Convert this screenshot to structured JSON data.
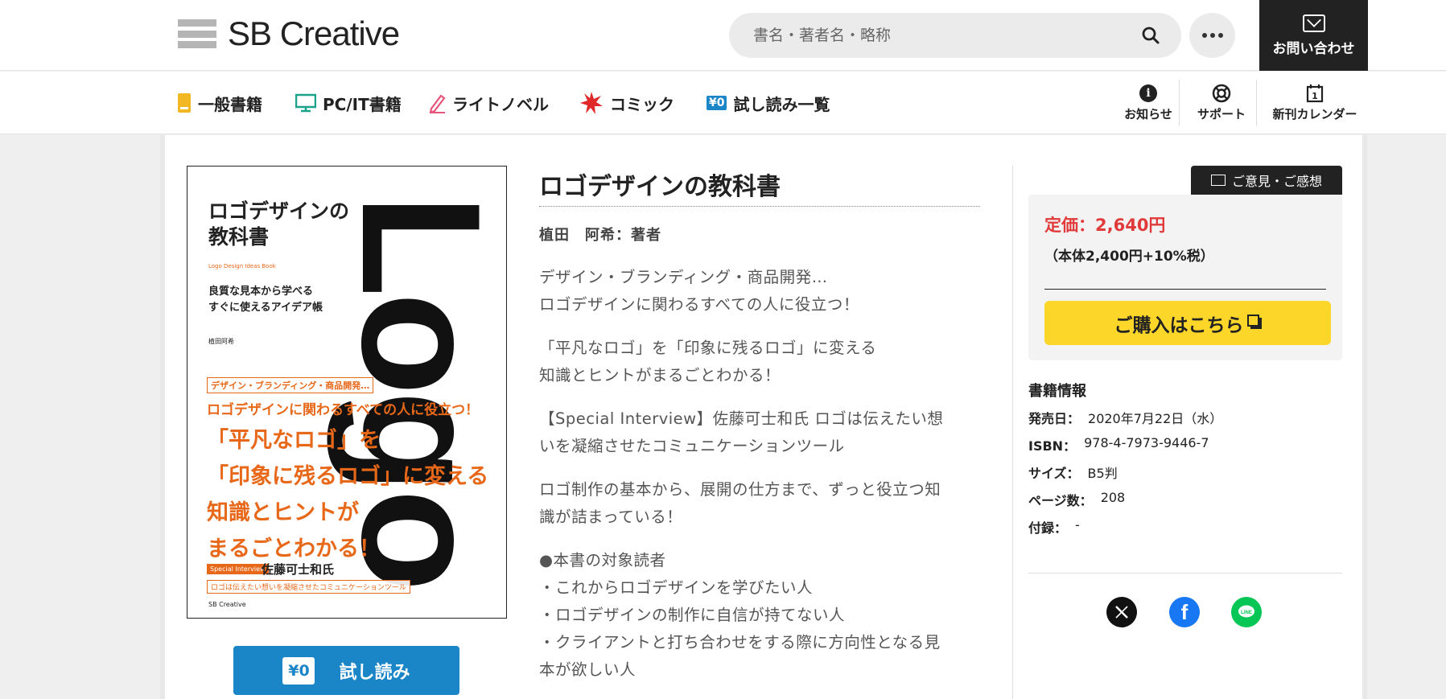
{
  "header": {
    "logo_text": "SB Creative",
    "search_placeholder": "書名・著者名・略称",
    "contact_label": "お問い合わせ"
  },
  "nav": {
    "items": [
      {
        "label": "一般書籍",
        "icon": "book-icon",
        "color": "#f2b824"
      },
      {
        "label": "PC/IT書籍",
        "icon": "monitor-icon",
        "color": "#1aa38a"
      },
      {
        "label": "ライトノベル",
        "icon": "pencil-icon",
        "color": "#e8557a"
      },
      {
        "label": "コミック",
        "icon": "burst-icon",
        "color": "#e02a2a"
      },
      {
        "label": "試し読み一覧",
        "icon": "yen-zero-icon",
        "color": "#1a86c8"
      }
    ],
    "right": [
      {
        "label": "お知らせ",
        "icon": "info-icon"
      },
      {
        "label": "サポート",
        "icon": "lifebuoy-icon"
      },
      {
        "label": "新刊カレンダー",
        "icon": "calendar-icon"
      }
    ]
  },
  "cover": {
    "title_line1": "ロゴデザインの",
    "title_line2": "教科書",
    "subtitle_en": "Logo Design Ideas Book",
    "tagline1": "良質な見本から学べる",
    "tagline2": "すぐに使えるアイデア帳",
    "author": "植田阿希",
    "big_letters": "Logo",
    "orange1": "デザイン・ブランディング・商品開発…",
    "orange2": "ロゴデザインに関わるすべての人に役立つ！",
    "orange3a": "「平凡なロゴ」を",
    "orange3b": "「印象に残るロゴ」に変える",
    "orange3c": "知識とヒントが",
    "orange3d": "まるごとわかる！",
    "interview_badge": "Special Interview",
    "interview_name": "佐藤可士和氏",
    "interview_sub": "ロゴは伝えたい想いを凝縮させたコミュニケーションツール",
    "publisher": "SB Creative"
  },
  "trial": {
    "badge": "¥0",
    "label": "試し読み"
  },
  "book": {
    "title": "ロゴデザインの教科書",
    "author": "植田　阿希：著者",
    "desc": [
      [
        "デザイン・ブランディング・商品開発…",
        "ロゴデザインに関わるすべての人に役立つ！"
      ],
      [
        "「平凡なロゴ」を「印象に残るロゴ」に変える",
        "知識とヒントがまるごとわかる！"
      ],
      [
        "【Special Interview】佐藤可士和氏 ロゴは伝えたい想",
        "いを凝縮させたコミュニケーションツール"
      ],
      [
        "ロゴ制作の基本から、展開の仕方まで、ずっと役立つ知",
        "識が詰まっている！"
      ],
      [
        "●本書の対象読者",
        "・これからロゴデザインを学びたい人",
        "・ロゴデザインの制作に自信が持てない人",
        "・クライアントと打ち合わせをする際に方向性となる見",
        "本が欲しい人"
      ]
    ]
  },
  "sidebar": {
    "feedback_label": "ご意見・ご感想",
    "price": "定価：2,640円",
    "price_sub": "（本体2,400円+10%税）",
    "buy_label": "ご購入はこちら",
    "info_title": "書籍情報",
    "info": [
      {
        "k": "発売日：",
        "v": "2020年7月22日（水）"
      },
      {
        "k": "ISBN：",
        "v": "978-4-7973-9446-7"
      },
      {
        "k": "サイズ：",
        "v": "B5判"
      },
      {
        "k": "ページ数：",
        "v": "208"
      },
      {
        "k": "付録：",
        "v": "-"
      }
    ],
    "share": [
      {
        "name": "x-icon",
        "color": "#111111"
      },
      {
        "name": "facebook-icon",
        "color": "#1877f2"
      },
      {
        "name": "line-icon",
        "color": "#06c755"
      }
    ]
  }
}
